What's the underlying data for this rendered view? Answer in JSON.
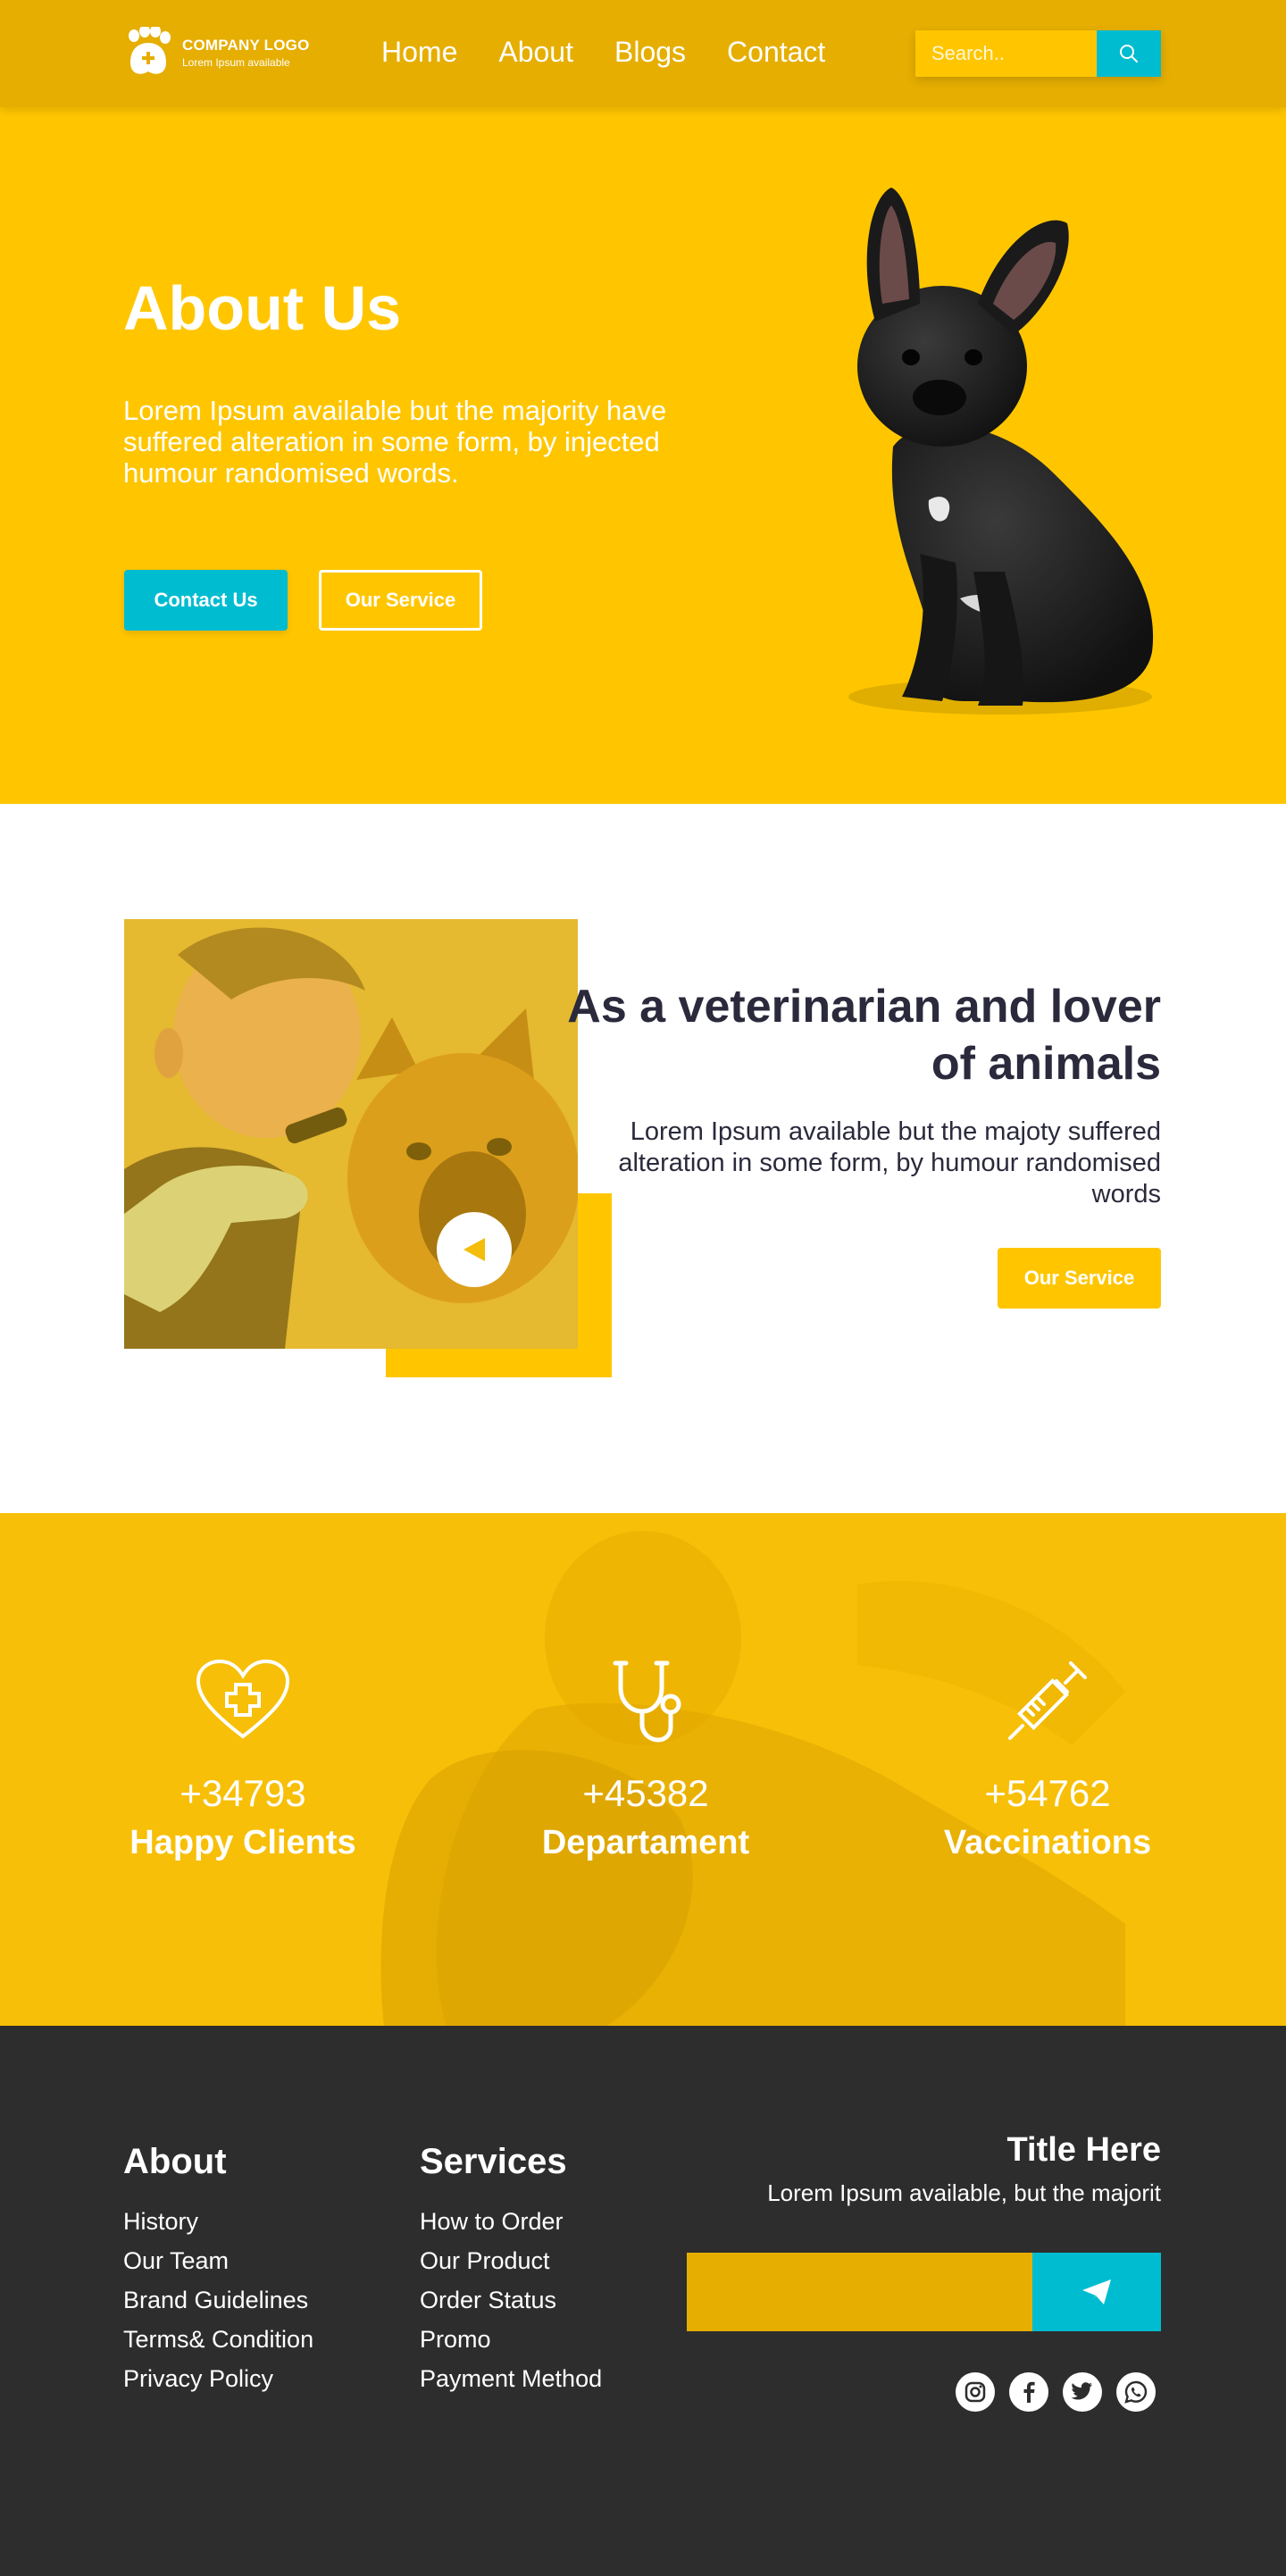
{
  "header": {
    "logo_title": "COMPANY LOGO",
    "logo_sub": "Lorem Ipsum available",
    "nav": [
      "Home",
      "About",
      "Blogs",
      "Contact"
    ],
    "search_placeholder": "Search..",
    "colors": {
      "header_bg": "#e6ae00",
      "accent": "#00bcd0"
    }
  },
  "hero": {
    "title": "About Us",
    "text": "Lorem Ipsum available but the majority have suffered alteration in some form, by injected humour randomised words.",
    "contact_button": "Contact Us",
    "service_button": "Our Service",
    "bg_color": "#ffc600"
  },
  "vet": {
    "title": "As a veterinarian and lover of animals",
    "text": "Lorem Ipsum available but the majoty suffered alteration in some form, by humour randomised words",
    "button": "Our Service"
  },
  "stats": [
    {
      "icon": "heart-cross-icon",
      "number": "+34793",
      "label": "Happy Clients"
    },
    {
      "icon": "stethoscope-icon",
      "number": "+45382",
      "label": "Departament"
    },
    {
      "icon": "syringe-icon",
      "number": "+54762",
      "label": "Vaccinations"
    }
  ],
  "footer": {
    "about_title": "About",
    "about_links": [
      "History",
      "Our Team",
      "Brand Guidelines",
      "Terms& Condition",
      "Privacy Policy"
    ],
    "services_title": "Services",
    "services_links": [
      "How to Order",
      "Our Product",
      "Order Status",
      "Promo",
      "Payment Method"
    ],
    "newsletter_title": "Title Here",
    "newsletter_sub": "Lorem Ipsum available, but the majorit",
    "socials": [
      "instagram-icon",
      "facebook-icon",
      "twitter-icon",
      "whatsapp-icon"
    ],
    "bg_color": "#2d2d2d"
  }
}
